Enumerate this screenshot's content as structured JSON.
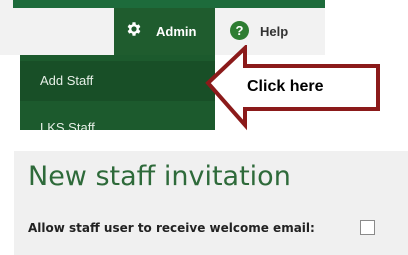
{
  "nav": {
    "admin_label": "Admin",
    "help_label": "Help",
    "help_icon_glyph": "?",
    "colors": {
      "bar": "#1d6b3b",
      "admin_tab": "#1f5c2e"
    }
  },
  "dropdown": {
    "items": [
      {
        "label": "Add Staff"
      },
      {
        "label": "LKS Staff"
      }
    ]
  },
  "callout": {
    "text": "Click here",
    "arrow_color": "#8b1a1a"
  },
  "panel": {
    "title": "New staff invitation",
    "welcome_email_label": "Allow staff user to receive welcome email:",
    "welcome_email_checked": false
  }
}
